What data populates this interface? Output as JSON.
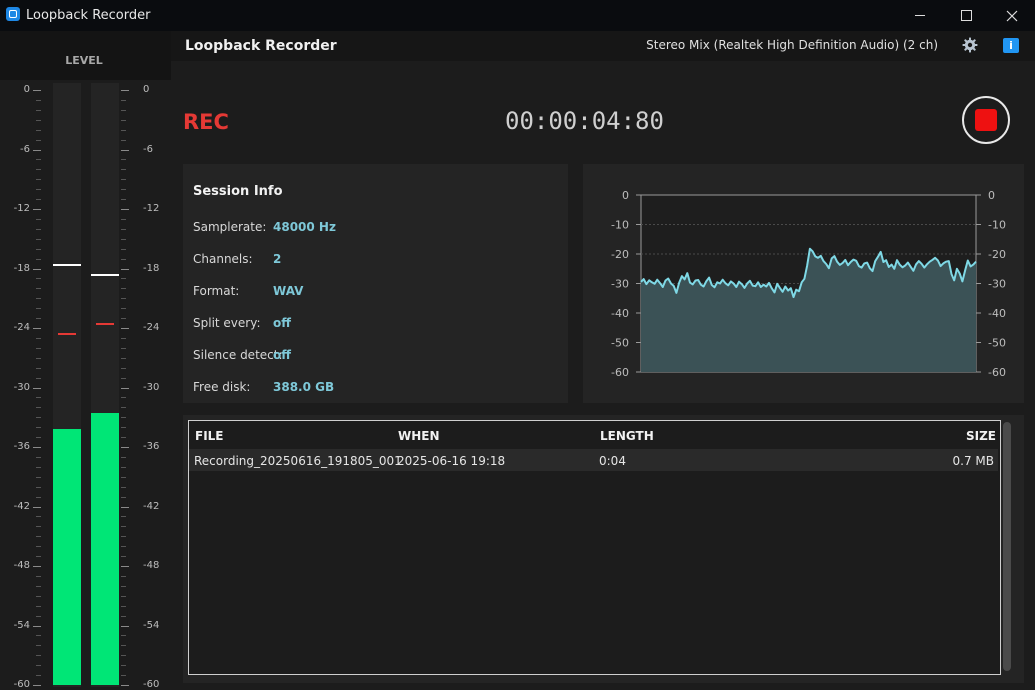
{
  "window": {
    "title": "Loopback Recorder"
  },
  "header": {
    "app_title": "Loopback Recorder",
    "device": "Stereo Mix (Realtek High Definition Audio) (2 ch)"
  },
  "level": {
    "title": "LEVEL",
    "ticks": [
      "0",
      "-6",
      "-12",
      "-18",
      "-24",
      "-30",
      "-36",
      "-42",
      "-48",
      "-54",
      "-60"
    ],
    "range": [
      -60,
      0
    ],
    "meters": [
      {
        "level_db": -34.2,
        "peak_db": -17.5,
        "hold_db": -24.5
      },
      {
        "level_db": -32.6,
        "peak_db": -18.6,
        "hold_db": -23.5
      }
    ],
    "colors": {
      "fill": "#00e676",
      "peak": "#ffffff",
      "hold": "#e53935"
    }
  },
  "recording": {
    "state": "REC",
    "timer": "00:00:04:80"
  },
  "session": {
    "title": "Session Info",
    "rows": [
      {
        "label": "Samplerate:",
        "value": "48000 Hz"
      },
      {
        "label": "Channels:",
        "value": "2"
      },
      {
        "label": "Format:",
        "value": "WAV"
      },
      {
        "label": "Split every:",
        "value": "off"
      },
      {
        "label": "Silence detect:",
        "value": "off"
      },
      {
        "label": "Free disk:",
        "value": "388.0 GB"
      }
    ]
  },
  "chart_data": {
    "type": "area",
    "ylim": [
      -60,
      0
    ],
    "yticks": [
      0,
      -10,
      -20,
      -30,
      -40,
      -50,
      -60
    ],
    "grid": true,
    "color": "#7fd9e6",
    "values": [
      -29.5,
      -28.5,
      -30.2,
      -28.9,
      -29.6,
      -30.1,
      -28.7,
      -29.9,
      -31.2,
      -29.0,
      -28.3,
      -30.0,
      -30.8,
      -33.2,
      -29.8,
      -27.5,
      -28.6,
      -26.5,
      -29.7,
      -30.3,
      -29.0,
      -28.8,
      -30.4,
      -31.0,
      -29.2,
      -28.0,
      -30.5,
      -31.3,
      -29.6,
      -30.0,
      -28.7,
      -29.9,
      -30.6,
      -29.3,
      -30.0,
      -31.2,
      -29.4,
      -30.2,
      -31.5,
      -30.0,
      -29.1,
      -30.7,
      -30.9,
      -29.6,
      -31.2,
      -30.4,
      -31.0,
      -29.8,
      -31.6,
      -33.0,
      -30.1,
      -31.5,
      -32.8,
      -31.0,
      -32.4,
      -31.6,
      -34.6,
      -32.1,
      -32.6,
      -29.6,
      -28.4,
      -24.0,
      -18.2,
      -19.1,
      -20.8,
      -21.3,
      -20.6,
      -22.4,
      -23.4,
      -24.8,
      -21.5,
      -20.7,
      -22.6,
      -23.7,
      -23.1,
      -22.0,
      -23.8,
      -22.7,
      -21.9,
      -22.3,
      -24.1,
      -24.6,
      -23.2,
      -22.9,
      -24.8,
      -25.8,
      -22.4,
      -20.9,
      -19.3,
      -22.7,
      -22.1,
      -24.4,
      -23.6,
      -25.0,
      -22.1,
      -23.6,
      -24.5,
      -23.9,
      -22.9,
      -24.3,
      -25.7,
      -23.5,
      -22.4,
      -23.3,
      -24.6,
      -23.5,
      -22.6,
      -22.0,
      -21.3,
      -22.2,
      -24.1,
      -23.2,
      -22.6,
      -22.4,
      -26.8,
      -28.9,
      -25.0,
      -26.6,
      -29.3,
      -25.6,
      -22.2,
      -24.2,
      -23.6,
      -22.6
    ]
  },
  "files": {
    "columns": [
      "FILE",
      "WHEN",
      "LENGTH",
      "SIZE"
    ],
    "rows": [
      {
        "file": "Recording_20250616_191805_001",
        "when": "2025-06-16 19:18",
        "length": "0:04",
        "size": "0.7 MB"
      }
    ]
  }
}
